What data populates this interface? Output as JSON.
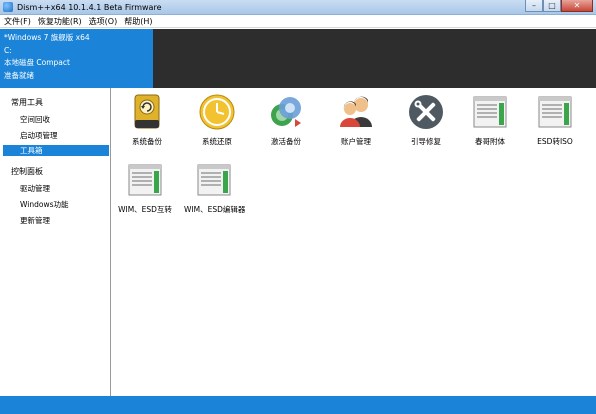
{
  "window": {
    "title": "Dism++x64 10.1.4.1 Beta Firmware",
    "minimize_glyph": "–",
    "maximize_glyph": "□",
    "close_glyph": "✕"
  },
  "menu": [
    "文件(F)",
    "恢复功能(R)",
    "选项(O)",
    "帮助(H)"
  ],
  "system_info": {
    "os": "*Windows 7 旗舰版 x64",
    "drive": "C:",
    "disk": "本地磁盘 Compact",
    "status": "准备就绪"
  },
  "sidebar": {
    "categories": [
      {
        "label": "常用工具",
        "items": [
          "空间回收",
          "启动项管理",
          "工具箱"
        ]
      },
      {
        "label": "控制面板",
        "items": [
          "驱动管理",
          "Windows功能",
          "更新管理"
        ]
      }
    ],
    "selected": "工具箱"
  },
  "tools": [
    {
      "label": "系统备份",
      "icon": "system-backup-icon"
    },
    {
      "label": "系统还原",
      "icon": "system-restore-icon"
    },
    {
      "label": "激活备份",
      "icon": "activation-backup-icon"
    },
    {
      "label": "账户管理",
      "icon": "account-management-icon"
    },
    {
      "label": "引导修复",
      "icon": "boot-repair-icon"
    },
    {
      "label": "春哥附体",
      "icon": "window-app-icon"
    },
    {
      "label": "ESD转ISO",
      "icon": "window-app-icon"
    },
    {
      "label": "WIM、ESD互转",
      "icon": "window-app-icon"
    },
    {
      "label": "WIM、ESD编辑器",
      "icon": "window-app-icon"
    }
  ],
  "colors": {
    "accent": "#1b84d8",
    "header_dark": "#2d2d2d",
    "selected_bg": "#1b84d8"
  }
}
